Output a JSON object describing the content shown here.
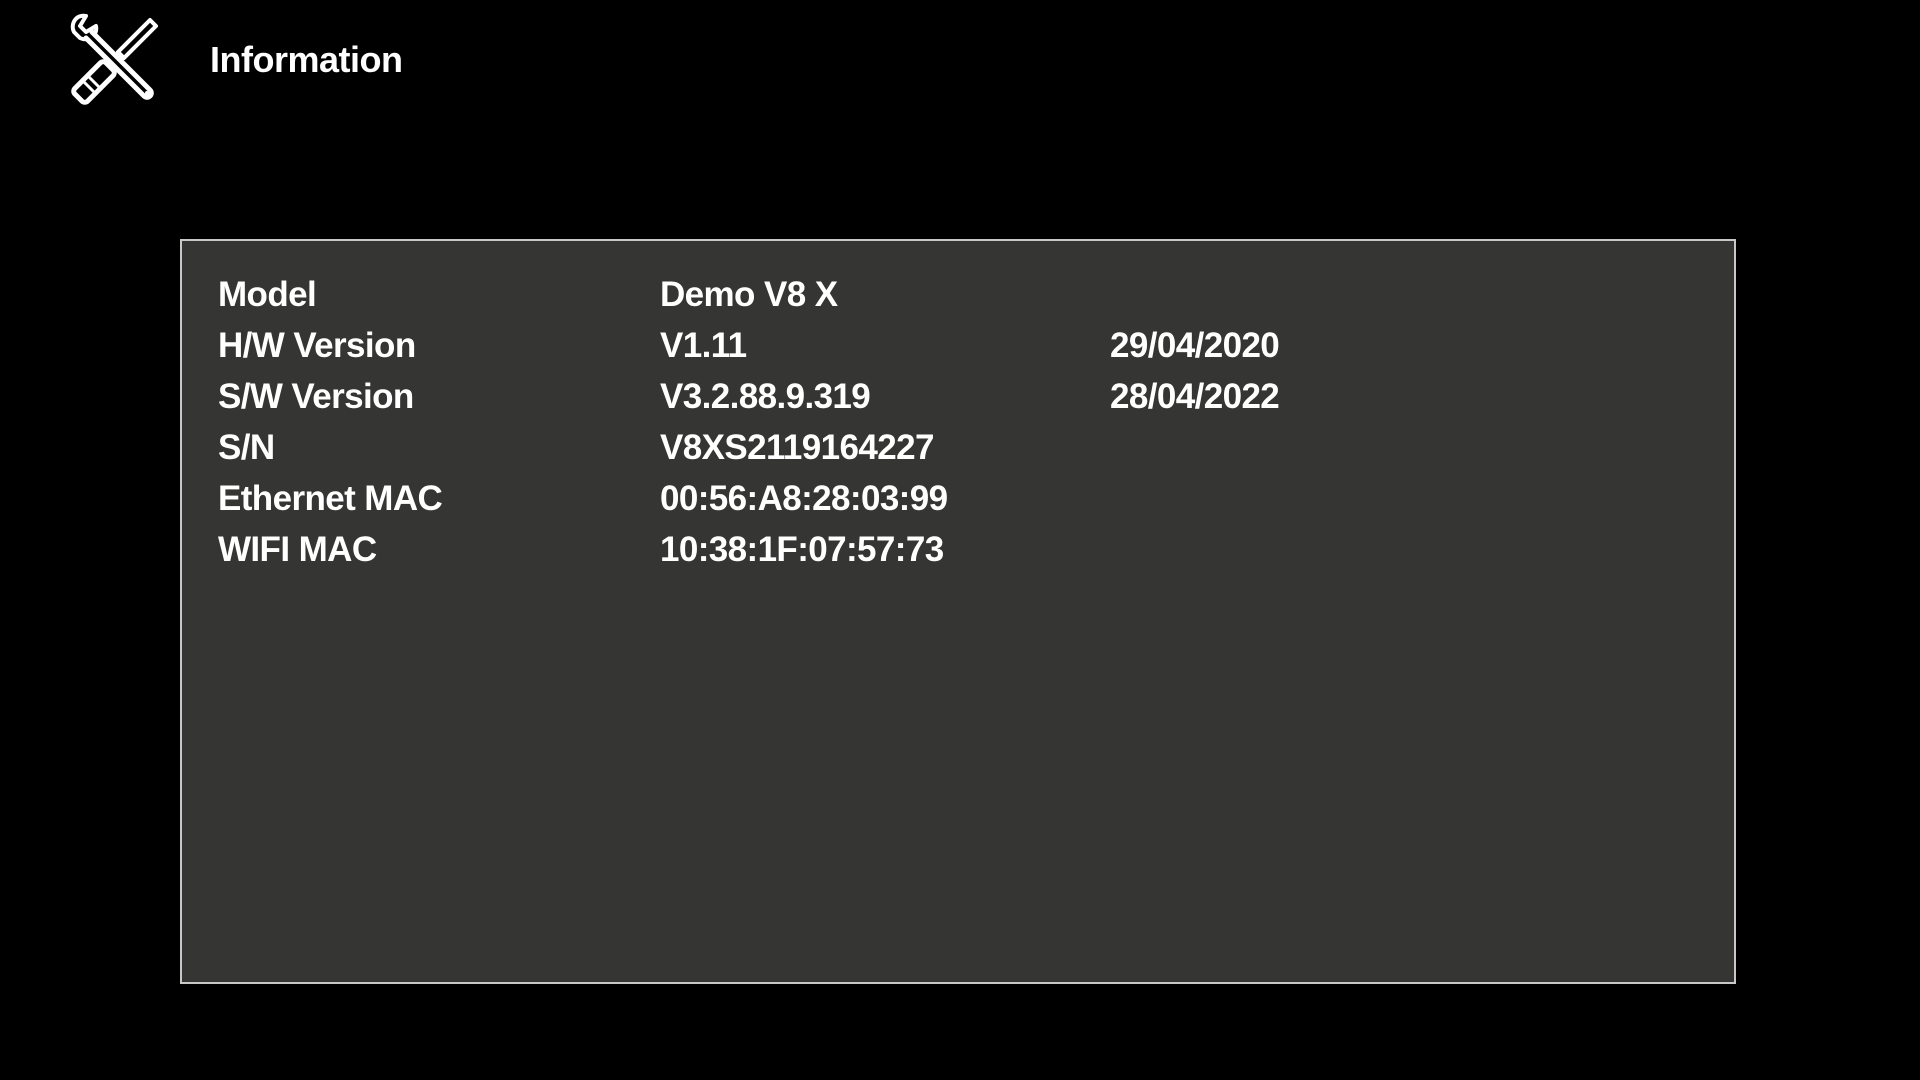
{
  "header": {
    "icon": "tools-icon",
    "title": "Information"
  },
  "info_rows": [
    {
      "label": "Model",
      "value": "Demo V8 X",
      "date": ""
    },
    {
      "label": "H/W Version",
      "value": "V1.11",
      "date": "29/04/2020"
    },
    {
      "label": "S/W Version",
      "value": "V3.2.88.9.319",
      "date": "28/04/2022"
    },
    {
      "label": "S/N",
      "value": "V8XS2119164227",
      "date": ""
    },
    {
      "label": "Ethernet MAC",
      "value": "00:56:A8:28:03:99",
      "date": ""
    },
    {
      "label": "WIFI MAC",
      "value": "10:38:1F:07:57:73",
      "date": ""
    }
  ],
  "colors": {
    "background": "#000000",
    "panel": "#353633",
    "panel_border": "#c8c8c8",
    "text": "#ffffff"
  }
}
